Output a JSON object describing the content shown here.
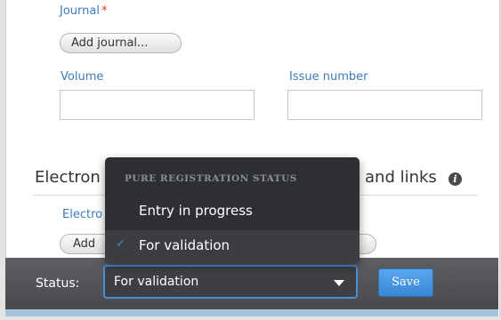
{
  "form": {
    "journal_label": "Journal",
    "required_mark": "*",
    "add_journal_button": "Add journal...",
    "volume_label": "Volume",
    "volume_value": "",
    "issue_label": "Issue number",
    "issue_value": "",
    "section_title_left": "Electron",
    "section_title_right": "and links",
    "sub_label": "Electro",
    "add_button_partial": "Add"
  },
  "dropdown": {
    "header": "PURE REGISTRATION STATUS",
    "items": [
      {
        "label": "Entry in progress",
        "selected": false
      },
      {
        "label": "For validation",
        "selected": true
      }
    ],
    "check_glyph": "✓"
  },
  "statusbar": {
    "label": "Status:",
    "selected_value": "For validation",
    "save_label": "Save"
  },
  "colors": {
    "accent": "#4a8fd6",
    "label_blue": "#3d7cb9",
    "required_red": "#dd3333",
    "statusbar_bg": "#525458"
  },
  "icons": {
    "info": "info-icon",
    "caret": "chevron-down-icon",
    "check": "check-icon"
  }
}
